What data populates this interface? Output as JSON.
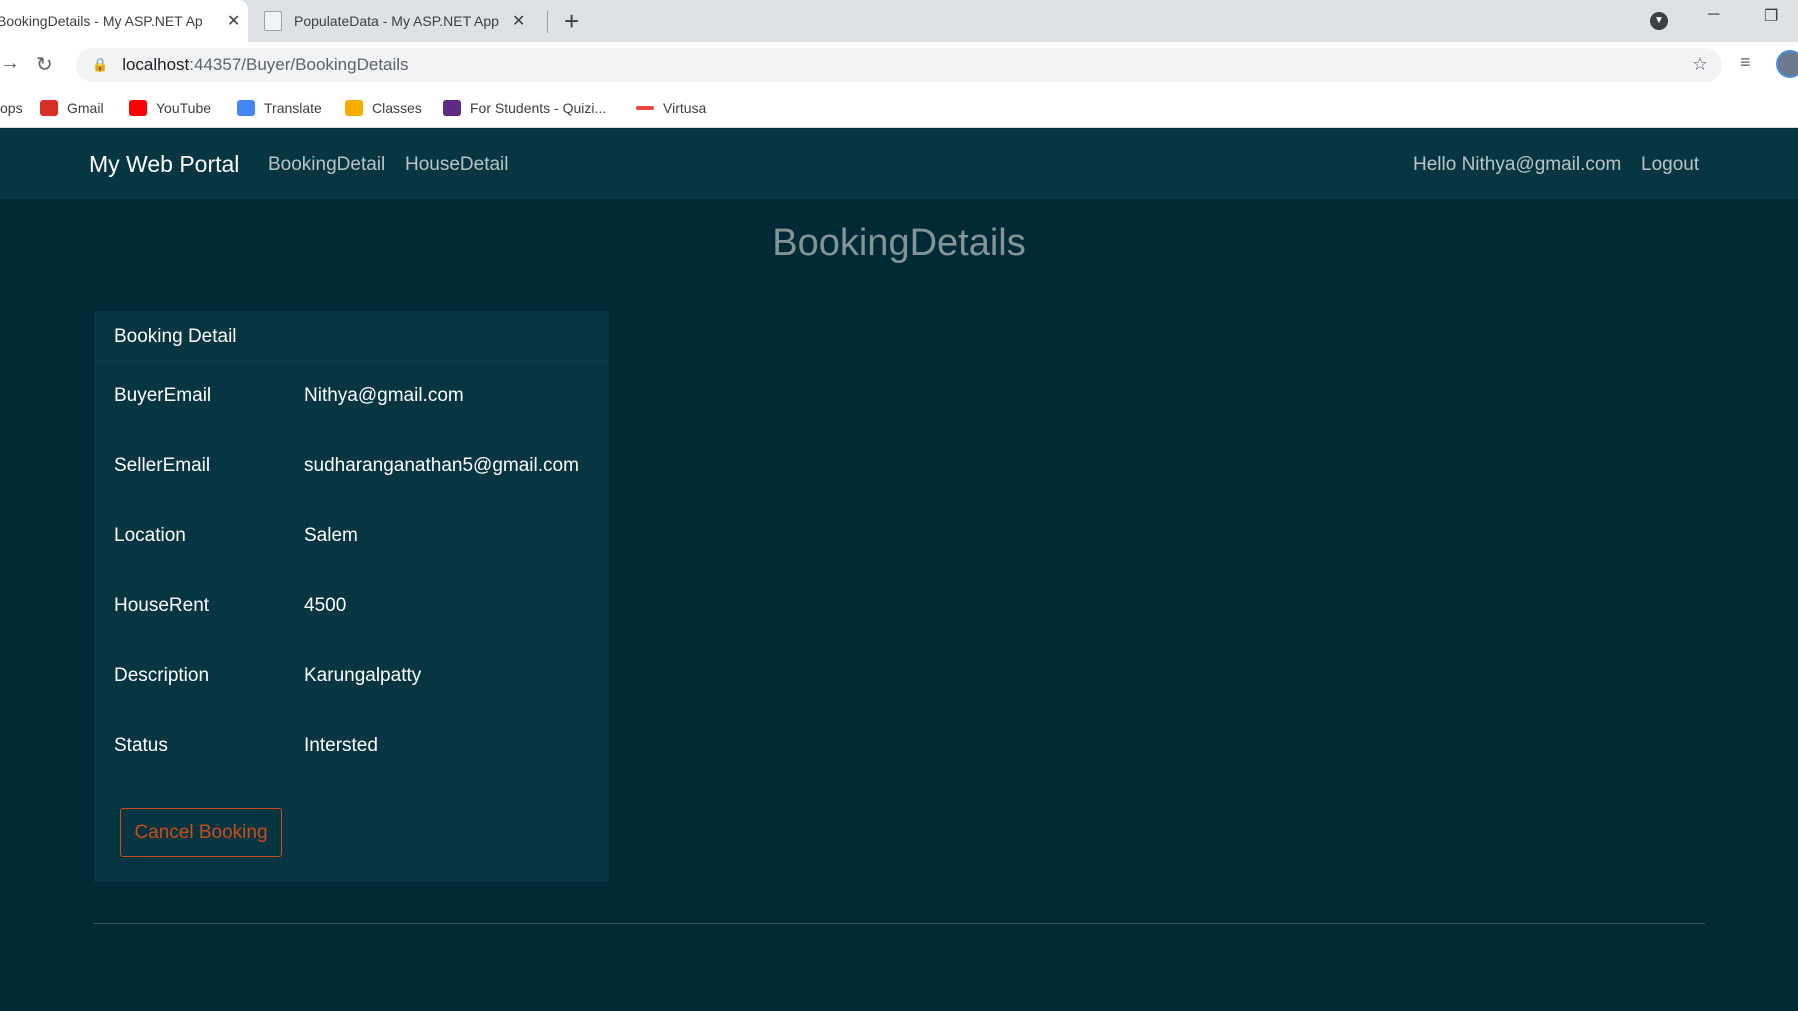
{
  "browser": {
    "tabs": [
      {
        "title": "BookingDetails - My ASP.NET Ap",
        "active": true
      },
      {
        "title": "PopulateData - My ASP.NET App",
        "active": false
      }
    ],
    "new_tab": "+",
    "url_host": "localhost",
    "url_path": ":44357/Buyer/BookingDetails",
    "bookmarks": [
      {
        "label": "ops",
        "icon": "apps-icon"
      },
      {
        "label": "Gmail",
        "icon": "gmail-icon",
        "color": "#d93025"
      },
      {
        "label": "YouTube",
        "icon": "youtube-icon",
        "color": "#ff0000"
      },
      {
        "label": "Translate",
        "icon": "translate-icon",
        "color": "#4285f4"
      },
      {
        "label": "Classes",
        "icon": "classroom-icon",
        "color": "#f9ab00"
      },
      {
        "label": "For Students - Quizi...",
        "icon": "quizizz-icon",
        "color": "#5e2a84"
      },
      {
        "label": "Virtusa",
        "icon": "virtusa-icon",
        "color": "#e8453c"
      }
    ]
  },
  "site": {
    "brand": "My Web Portal",
    "nav": [
      "BookingDetail",
      "HouseDetail"
    ],
    "greeting": "Hello Nithya@gmail.com",
    "logout": "Logout"
  },
  "page": {
    "title": "BookingDetails",
    "card_title": "Booking Detail",
    "fields": [
      {
        "label": "BuyerEmail",
        "value": "Nithya@gmail.com"
      },
      {
        "label": "SellerEmail",
        "value": "sudharanganathan5@gmail.com"
      },
      {
        "label": "Location",
        "value": "Salem"
      },
      {
        "label": "HouseRent",
        "value": "4500"
      },
      {
        "label": "Description",
        "value": "Karungalpatty"
      },
      {
        "label": "Status",
        "value": "Intersted"
      }
    ],
    "cancel_button": "Cancel Booking"
  },
  "colors": {
    "page_bg": "#002b36",
    "nav_bg": "#073642",
    "accent": "#cb4b16",
    "title": "#839496"
  }
}
